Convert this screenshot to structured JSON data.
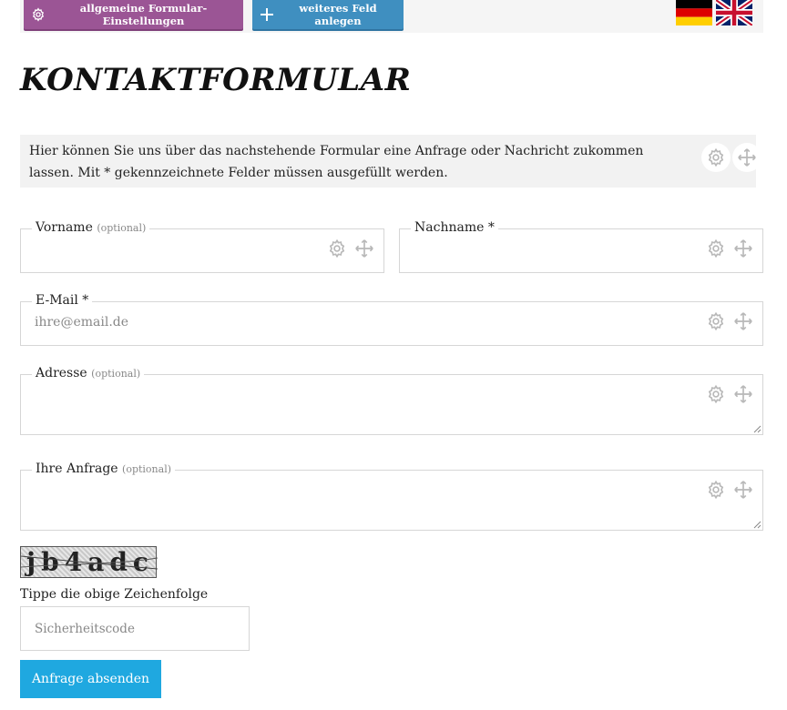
{
  "toolbar": {
    "settings_label": "allgemeine Formular-Einstellungen",
    "add_field_label": "weiteres Feld anlegen",
    "settings_color": "#9b5595",
    "add_color": "#3f8fc0"
  },
  "languages": [
    {
      "name": "german-flag-icon"
    },
    {
      "name": "english-flag-icon"
    }
  ],
  "form": {
    "title": "KONTAKTFORMULAR",
    "intro": "Hier können Sie uns über das nachstehende Formular eine Anfrage oder Nachricht zukommen lassen. Mit * gekennzeichnete Felder müssen ausgefüllt werden.",
    "optional_marker": "(optional)",
    "fields": {
      "vorname": {
        "label": "Vorname",
        "optional": "(optional)"
      },
      "nachname": {
        "label": "Nachname *"
      },
      "email": {
        "label": "E-Mail *",
        "placeholder": "ihre@email.de"
      },
      "adresse": {
        "label": "Adresse",
        "optional": "(optional)"
      },
      "anfrage": {
        "label": "Ihre Anfrage",
        "optional": "(optional)"
      }
    },
    "captcha": {
      "text": "jb4adc",
      "label": "Tippe die obige Zeichenfolge",
      "placeholder": "Sicherheitscode"
    },
    "submit_label": "Anfrage absenden",
    "submit_color": "#1fa8e0"
  }
}
